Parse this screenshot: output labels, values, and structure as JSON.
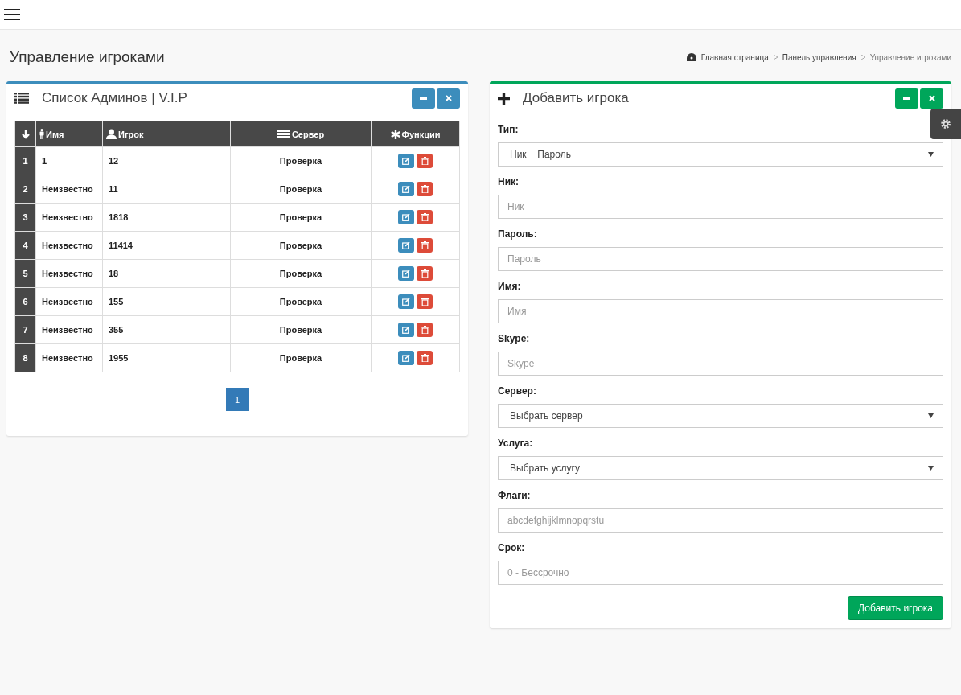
{
  "page_title": "Управление игроками",
  "breadcrumbs": [
    {
      "label": "Главная страница"
    },
    {
      "label": "Панель управления"
    },
    {
      "label": "Управление игроками"
    }
  ],
  "admins_panel": {
    "title": "Список Админов | V.I.P",
    "table": {
      "columns": [
        {
          "label": "Имя"
        },
        {
          "label": "Игрок"
        },
        {
          "label": "Сервер"
        },
        {
          "label": "Функции"
        }
      ],
      "rows": [
        {
          "num": "1",
          "name": "1",
          "player": "12",
          "server": "Проверка"
        },
        {
          "num": "2",
          "name": "Неизвестно",
          "player": "11",
          "server": "Проверка"
        },
        {
          "num": "3",
          "name": "Неизвестно",
          "player": "1818",
          "server": "Проверка"
        },
        {
          "num": "4",
          "name": "Неизвестно",
          "player": "11414",
          "server": "Проверка"
        },
        {
          "num": "5",
          "name": "Неизвестно",
          "player": "18",
          "server": "Проверка"
        },
        {
          "num": "6",
          "name": "Неизвестно",
          "player": "155",
          "server": "Проверка"
        },
        {
          "num": "7",
          "name": "Неизвестно",
          "player": "355",
          "server": "Проверка"
        },
        {
          "num": "8",
          "name": "Неизвестно",
          "player": "1955",
          "server": "Проверка"
        }
      ]
    },
    "pagination": [
      {
        "label": "1",
        "selected": true
      }
    ]
  },
  "add_panel": {
    "title": "Добавить игрока",
    "fields": [
      {
        "kind": "select",
        "label": "Тип:",
        "value": "Ник + Пароль"
      },
      {
        "kind": "input",
        "label": "Ник:",
        "placeholder": "Ник"
      },
      {
        "kind": "input",
        "label": "Пароль:",
        "placeholder": "Пароль"
      },
      {
        "kind": "input",
        "label": "Имя:",
        "placeholder": "Имя"
      },
      {
        "kind": "input",
        "label": "Skype:",
        "placeholder": "Skype"
      },
      {
        "kind": "select",
        "label": "Сервер:",
        "value": "Выбрать сервер"
      },
      {
        "kind": "select",
        "label": "Услуга:",
        "value": "Выбрать услугу"
      },
      {
        "kind": "input",
        "label": "Флаги:",
        "placeholder": "abcdefghijklmnopqrstu"
      },
      {
        "kind": "input",
        "label": "Срок:",
        "placeholder": "0 - Бессрочно"
      }
    ],
    "submit": "Добавить игрока"
  }
}
